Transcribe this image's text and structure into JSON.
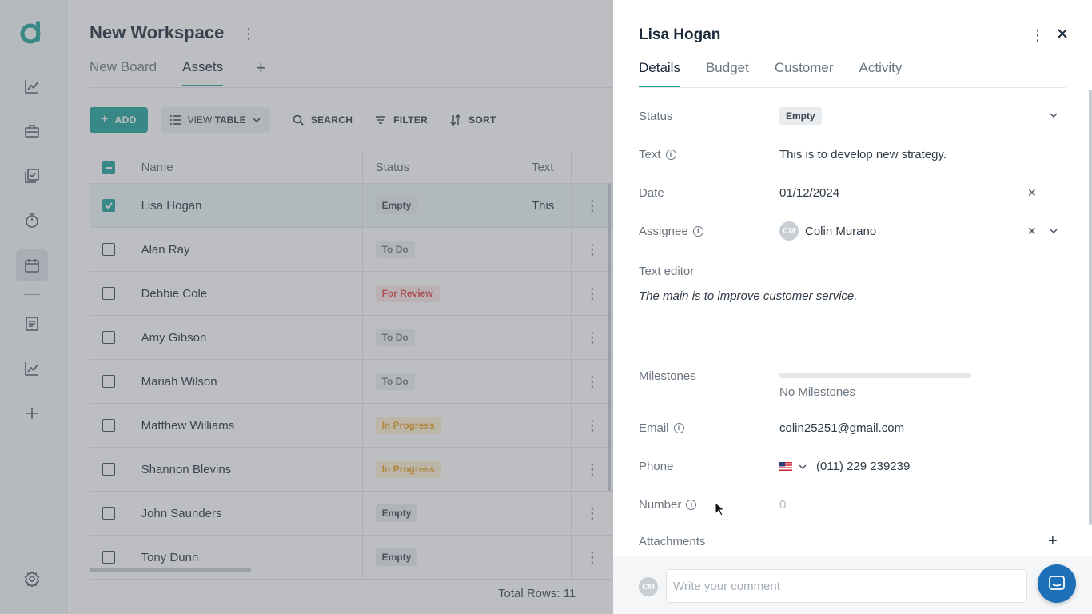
{
  "workspace": {
    "title": "New Workspace",
    "tabs": [
      {
        "label": "New Board"
      },
      {
        "label": "Assets"
      }
    ],
    "active_tab": "Assets"
  },
  "toolbar": {
    "add_label": "ADD",
    "view_label_prefix": "VIEW",
    "view_label_value": "TABLE",
    "search_label": "SEARCH",
    "filter_label": "FILTER",
    "sort_label": "SORT"
  },
  "table": {
    "columns": {
      "name": "Name",
      "status": "Status",
      "text": "Text"
    },
    "rows": [
      {
        "name": "Lisa Hogan",
        "status": "Empty",
        "text": "This",
        "selected": true
      },
      {
        "name": "Alan Ray",
        "status": "To Do",
        "text": ""
      },
      {
        "name": "Debbie Cole",
        "status": "For Review",
        "text": ""
      },
      {
        "name": "Amy Gibson",
        "status": "To Do",
        "text": ""
      },
      {
        "name": "Mariah Wilson",
        "status": "To Do",
        "text": ""
      },
      {
        "name": "Matthew Williams",
        "status": "In Progress",
        "text": ""
      },
      {
        "name": "Shannon Blevins",
        "status": "In Progress",
        "text": ""
      },
      {
        "name": "John Saunders",
        "status": "Empty",
        "text": ""
      },
      {
        "name": "Tony Dunn",
        "status": "Empty",
        "text": ""
      }
    ],
    "total_rows": "Total Rows: 11"
  },
  "drawer": {
    "title": "Lisa Hogan",
    "tabs": [
      {
        "label": "Details"
      },
      {
        "label": "Budget"
      },
      {
        "label": "Customer"
      },
      {
        "label": "Activity"
      }
    ],
    "active_tab": "Details",
    "fields": {
      "status": {
        "label": "Status",
        "value": "Empty"
      },
      "text": {
        "label": "Text",
        "value": "This is to develop new strategy."
      },
      "date": {
        "label": "Date",
        "value": "01/12/2024"
      },
      "assignee": {
        "label": "Assignee",
        "initials": "CM",
        "value": "Colin Murano"
      },
      "text_editor": {
        "label": "Text editor",
        "value": "The main is to improve customer service."
      },
      "milestones": {
        "label": "Milestones",
        "value": "No Milestones",
        "progress": 0
      },
      "email": {
        "label": "Email",
        "value": "colin25251@gmail.com"
      },
      "phone": {
        "label": "Phone",
        "value": "(011) 229 239239"
      },
      "number": {
        "label": "Number",
        "value": "0"
      },
      "attachments": {
        "label": "Attachments"
      }
    },
    "comment": {
      "avatar_initials": "CM",
      "placeholder": "Write your comment"
    }
  },
  "colors": {
    "accent": "#1aa39a",
    "status_empty": "#e9ecef",
    "status_for_review": "#e04545",
    "status_in_progress": "#e8a020",
    "chat_button": "#1d6fb8"
  }
}
